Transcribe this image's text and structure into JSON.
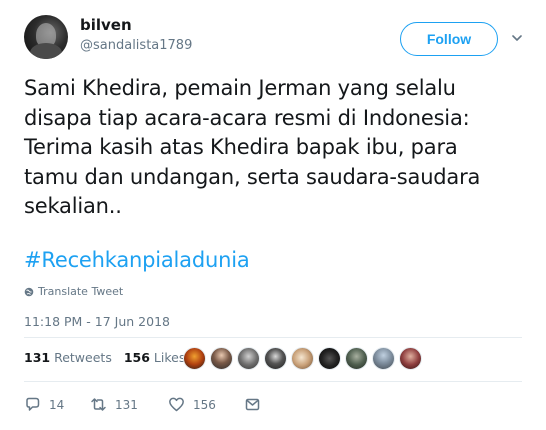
{
  "tweet": {
    "display_name": "bilven",
    "username": "@sandalista1789",
    "follow_label": "Follow",
    "text_lines": [
      "Sami Khedira, pemain Jerman yang selalu",
      "disapa tiap acara-acara resmi di Indonesia:",
      "Terima kasih atas Khedira bapak ibu, para",
      "tamu dan undangan, serta saudara-saudara",
      "sekalian.."
    ],
    "hashtag": "#Recehkanpialadunia",
    "translate_label": "Translate Tweet",
    "timestamp": "11:18 PM - 17 Jun 2018"
  },
  "stats": {
    "retweets_count": "131",
    "retweets_label": "Retweets",
    "likes_count": "156",
    "likes_label": "Likes"
  },
  "liker_avatars": [
    "avatar-1",
    "avatar-2",
    "avatar-3",
    "avatar-4",
    "avatar-5",
    "avatar-6",
    "avatar-7",
    "avatar-8",
    "avatar-9"
  ],
  "actions": {
    "reply_count": "14",
    "retweet_count": "131",
    "like_count": "156"
  },
  "colors": {
    "accent": "#1da1f2",
    "text": "#14171a",
    "secondary": "#657786",
    "divider": "#e6ecf0"
  }
}
